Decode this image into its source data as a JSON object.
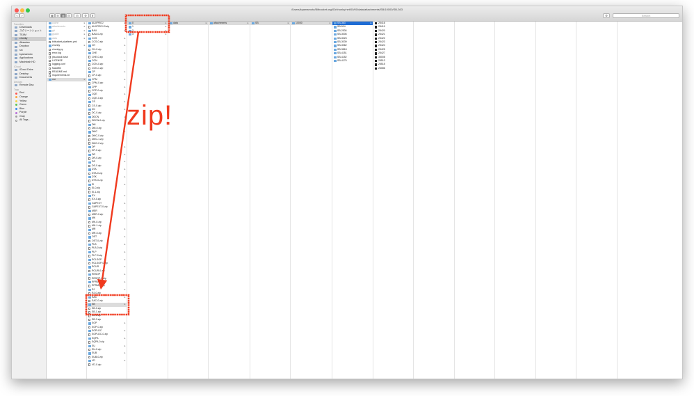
{
  "window": {
    "path_title": "/Users/kyamamoto/Bitbucket.org/00/chunky/net/00/00/data/attachments/SB/10000/SB-363",
    "search_placeholder": "Search",
    "toolbar": [
      "<",
      ">",
      "▦",
      "☰",
      "▥",
      "⊟",
      "⚙",
      "⬆"
    ]
  },
  "sidebar": {
    "sections": [
      {
        "heading": "Favorites",
        "items": [
          "Downloads",
          "スクリーンショット",
          "TEAM",
          "chunky",
          "Atlassian",
          "Dropbox",
          "src",
          "kyamamoto",
          "Applications",
          "Macintosh HD"
        ]
      },
      {
        "heading": "iCloud",
        "items": [
          "iCloud Drive",
          "Desktop",
          "Documents"
        ]
      },
      {
        "heading": "Devices",
        "items": [
          "Remote Disc"
        ]
      },
      {
        "heading": "Tags",
        "items": [
          "Red",
          "Orange",
          "Yellow",
          "Green",
          "Blue",
          "Purple",
          "Gray",
          "All Tags..."
        ]
      }
    ],
    "selected": "chunky",
    "tag_colors": {
      "Red": "#fc5753",
      "Orange": "#fda53a",
      "Yellow": "#f7d34a",
      "Green": "#5fc455",
      "Blue": "#3b8ef0",
      "Purple": "#b970d9",
      "Gray": "#a0a0a0",
      "All Tags...": "#ffffff"
    }
  },
  "col1": [
    {
      "name": "cache",
      "grey": true,
      "folder": true
    },
    {
      "name": "attachments",
      "grey": true,
      "folder": true
    },
    {
      "name": "git",
      "grey": true,
      "folder": true
    },
    {
      "name": "gradle",
      "grey": true,
      "folder": true
    },
    {
      "name": "data",
      "grey": true,
      "folder": true
    },
    {
      "name": "bitbucket-pipelines.yml",
      "file": true
    },
    {
      "name": "chunky",
      "folder": true
    },
    {
      "name": "chunky.py",
      "file": true
    },
    {
      "name": "error.log",
      "file": true
    },
    {
      "name": "jira-cloud.bash",
      "file": true
    },
    {
      "name": "LICENSE",
      "file": true
    },
    {
      "name": "logging.conf",
      "file": true
    },
    {
      "name": "Makefile",
      "file": true
    },
    {
      "name": "README.md",
      "file": true
    },
    {
      "name": "requirements.txt",
      "file": true
    },
    {
      "name": "var",
      "folder": true,
      "sel": true
    }
  ],
  "col2": [
    "AUXPROJ",
    "AUXPROJ-0.zip",
    "BAU",
    "BAU-0.zip",
    "CCS",
    "CCS-0.zip",
    "CH",
    "CH-0.zip",
    "CHE",
    "CHE-0.zip",
    "CON",
    "CON-0.zip",
    "CON-1.zip",
    "CP",
    "CP-0.zip",
    "CPM",
    "CPM-0.zip",
    "CPP",
    "CPP-0.zip",
    "CQE",
    "CQE-0.zip",
    "CS",
    "CS-0.zip",
    "DC",
    "DC-0.zip",
    "DDCN",
    "DDCN-0.zip",
    "DM",
    "DM-0.zip",
    "DMC",
    "DMC-0.zip",
    "DMC-1.zip",
    "DMC-2.zip",
    "DP",
    "DP-0.zip",
    "DR",
    "DR-0.zip",
    "DS",
    "DS-0.zip",
    "DTA",
    "DTA-0.zip",
    "DTK",
    "DTK-0.zip",
    "EI",
    "EI-0.zip",
    "EI-1.zip",
    "EX",
    "EX-0.zip",
    "GAPEXT",
    "GAPEXT-0.zip",
    "MER",
    "MER-0.zip",
    "MK",
    "MK-0.zip",
    "MK-1.zip",
    "MR",
    "MR-0.zip",
    "OST",
    "OST-0.zip",
    "PLB",
    "PLB-0.zip",
    "PLP",
    "PLP-0.zip",
    "RCLSOP",
    "RCLSOP-0.zip",
    "RCUR",
    "RCUR-0.zip",
    "RESOP",
    "RESOP-0.zip",
    "RFRM",
    "RFRM-0.zip",
    "RJ",
    "RJ-0.zip",
    "SAC",
    "SAC-0.zip",
    "SB",
    "SB-0.zip",
    "SB-1.zip",
    "SB-2.zip",
    "SB-3.zip",
    "SOP",
    "SOP-0.zip",
    "SOPLDC",
    "SOPLDC-0.zip",
    "SQPA",
    "SQPA-0.zip",
    "SU",
    "SU-0.zip",
    "SUB",
    "SUB-0.zip",
    "VD",
    "VD-0.zip"
  ],
  "col3": [
    "0",
    "1",
    "2",
    "3"
  ],
  "col4": [
    "data"
  ],
  "col5": [
    "attachments"
  ],
  "col6": [
    "SB"
  ],
  "col7": [
    "10000"
  ],
  "col8": [
    "SB-363",
    "SB-524",
    "SB-2534",
    "SB-3006",
    "SB-3023",
    "SB-3039",
    "SB-3062",
    "SB-3818",
    "SB-4151",
    "SB-4152",
    "SB-4170"
  ],
  "col9": [
    "25416",
    "25419",
    "25420",
    "25421",
    "25422",
    "25423",
    "25424",
    "25425",
    "25427",
    "35008",
    "25513",
    "25515",
    "26086"
  ],
  "annotation": {
    "text": "zip!",
    "color": "#f03a1e"
  }
}
